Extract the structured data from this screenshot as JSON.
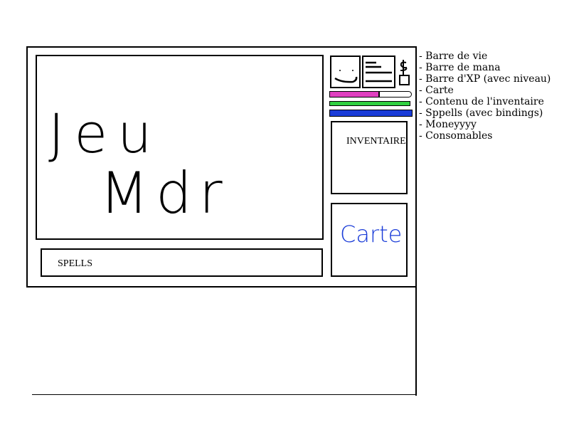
{
  "game_view": {
    "title_line1": "Jeu",
    "title_line2": "Mdr"
  },
  "spells": {
    "label": "SPELLS"
  },
  "inventory": {
    "label": "INVENTAIRE"
  },
  "map": {
    "label": "Carte",
    "color": "#1a3cd8"
  },
  "bars": {
    "health": {
      "color": "#e040c0",
      "fill": 0.6
    },
    "mana": {
      "color": "#30d040",
      "fill": 1.0
    },
    "xp": {
      "color": "#1a3cd8",
      "fill": 1.0
    }
  },
  "notes": [
    "- Barre de vie",
    "- Barre de mana",
    "- Barre d'XP (avec niveau)",
    "- Carte",
    "- Contenu de l'inventaire",
    "- Sppells (avec bindings)",
    "- Moneyyyy",
    "- Consomables"
  ]
}
